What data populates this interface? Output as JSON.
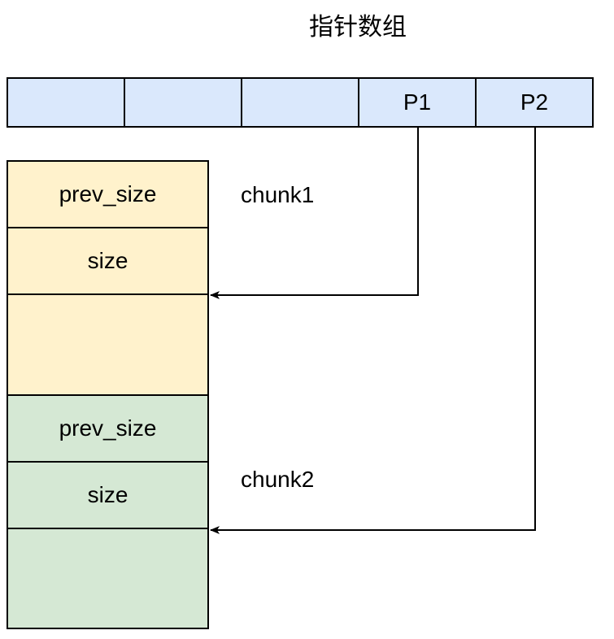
{
  "title": "指针数组",
  "pointer_array": {
    "cells": [
      "",
      "",
      "",
      "P1",
      "P2"
    ]
  },
  "heap": {
    "chunk1": {
      "label": "chunk1",
      "fields": [
        "prev_size",
        "size",
        ""
      ]
    },
    "chunk2": {
      "label": "chunk2",
      "fields": [
        "prev_size",
        "size",
        ""
      ]
    }
  },
  "colors": {
    "pointer_array_fill": "#dae8fc",
    "chunk1_fill": "#fff2cc",
    "chunk2_fill": "#d5e8d4",
    "stroke": "#000000"
  }
}
